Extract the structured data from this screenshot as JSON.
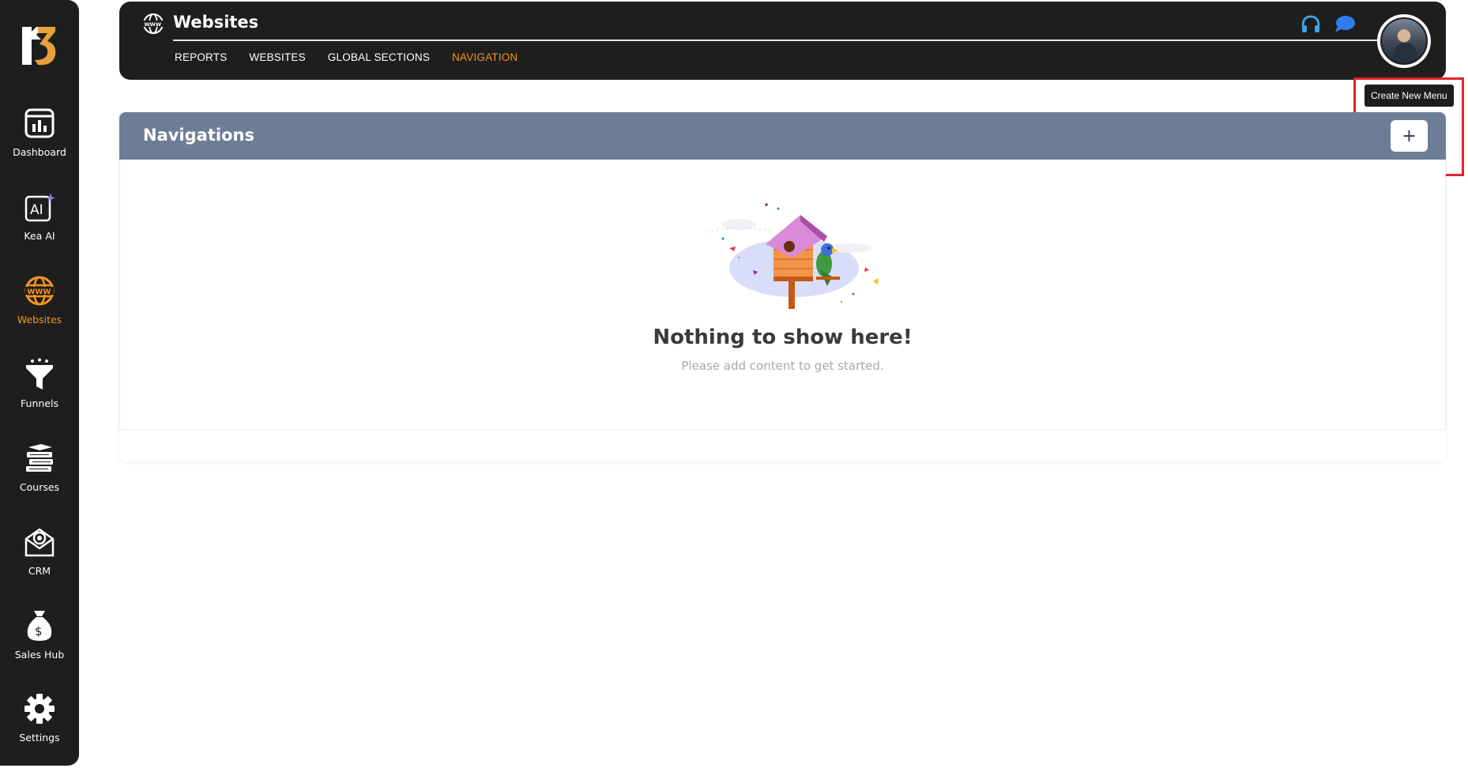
{
  "sidebar": {
    "items": [
      {
        "label": "Dashboard"
      },
      {
        "label": "Kea AI"
      },
      {
        "label": "Websites"
      },
      {
        "label": "Funnels"
      },
      {
        "label": "Courses"
      },
      {
        "label": "CRM"
      },
      {
        "label": "Sales Hub"
      },
      {
        "label": "Settings"
      }
    ],
    "active": "Websites"
  },
  "header": {
    "title": "Websites",
    "tabs": [
      {
        "label": "REPORTS"
      },
      {
        "label": "WEBSITES"
      },
      {
        "label": "GLOBAL SECTIONS"
      },
      {
        "label": "NAVIGATION"
      }
    ],
    "active_tab": "NAVIGATION"
  },
  "tooltip": {
    "text": "Create New Menu"
  },
  "panel": {
    "title": "Navigations",
    "add_label": "+",
    "empty_title": "Nothing to show here!",
    "empty_subtitle": "Please add content to get started."
  },
  "colors": {
    "sidebar_bg": "#1e1e1e",
    "accent": "#f7941d",
    "panel_header": "#6e7d96",
    "highlight": "#e3242b"
  }
}
